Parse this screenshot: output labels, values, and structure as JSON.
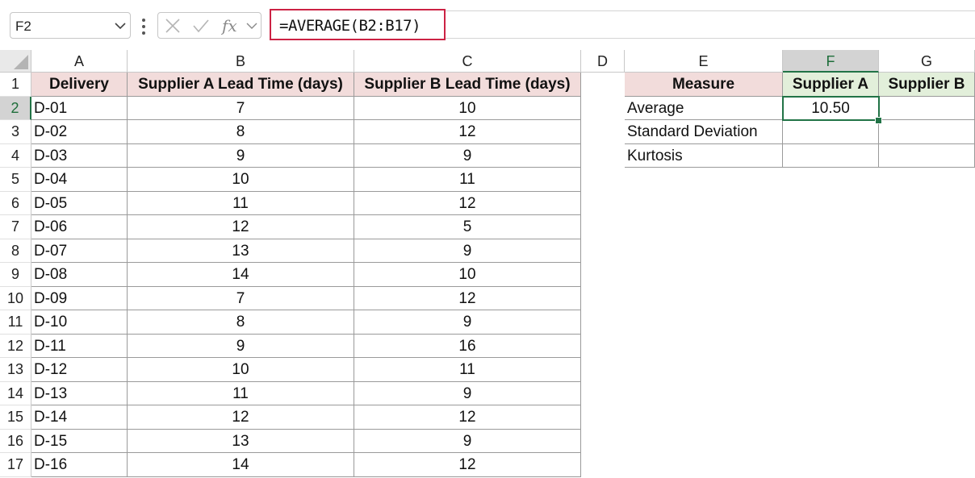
{
  "formula_bar": {
    "name_box": "F2",
    "formula": "=AVERAGE(B2:B17)"
  },
  "columns": [
    "A",
    "B",
    "C",
    "D",
    "E",
    "F",
    "G"
  ],
  "rows": [
    "1",
    "2",
    "3",
    "4",
    "5",
    "6",
    "7",
    "8",
    "9",
    "10",
    "11",
    "12",
    "13",
    "14",
    "15",
    "16",
    "17"
  ],
  "headers": {
    "a1": "Delivery",
    "b1": "Supplier A Lead Time (days)",
    "c1": "Supplier B Lead Time (days)",
    "e1": "Measure",
    "f1": "Supplier A",
    "g1": "Supplier B"
  },
  "data": [
    [
      "D-01",
      "7",
      "10"
    ],
    [
      "D-02",
      "8",
      "12"
    ],
    [
      "D-03",
      "9",
      "9"
    ],
    [
      "D-04",
      "10",
      "11"
    ],
    [
      "D-05",
      "11",
      "12"
    ],
    [
      "D-06",
      "12",
      "5"
    ],
    [
      "D-07",
      "13",
      "9"
    ],
    [
      "D-08",
      "14",
      "10"
    ],
    [
      "D-09",
      "7",
      "12"
    ],
    [
      "D-10",
      "8",
      "9"
    ],
    [
      "D-11",
      "9",
      "16"
    ],
    [
      "D-12",
      "10",
      "11"
    ],
    [
      "D-13",
      "11",
      "9"
    ],
    [
      "D-14",
      "12",
      "12"
    ],
    [
      "D-15",
      "13",
      "9"
    ],
    [
      "D-16",
      "14",
      "12"
    ]
  ],
  "measures": [
    {
      "label": "Average",
      "supplier_a": "10.50",
      "supplier_b": ""
    },
    {
      "label": "Standard Deviation",
      "supplier_a": "",
      "supplier_b": ""
    },
    {
      "label": "Kurtosis",
      "supplier_a": "",
      "supplier_b": ""
    }
  ],
  "colors": {
    "header_pink": "#f2dcdb",
    "header_green": "#e2efda",
    "selection_green": "#217346",
    "formula_highlight": "#cc2244"
  }
}
